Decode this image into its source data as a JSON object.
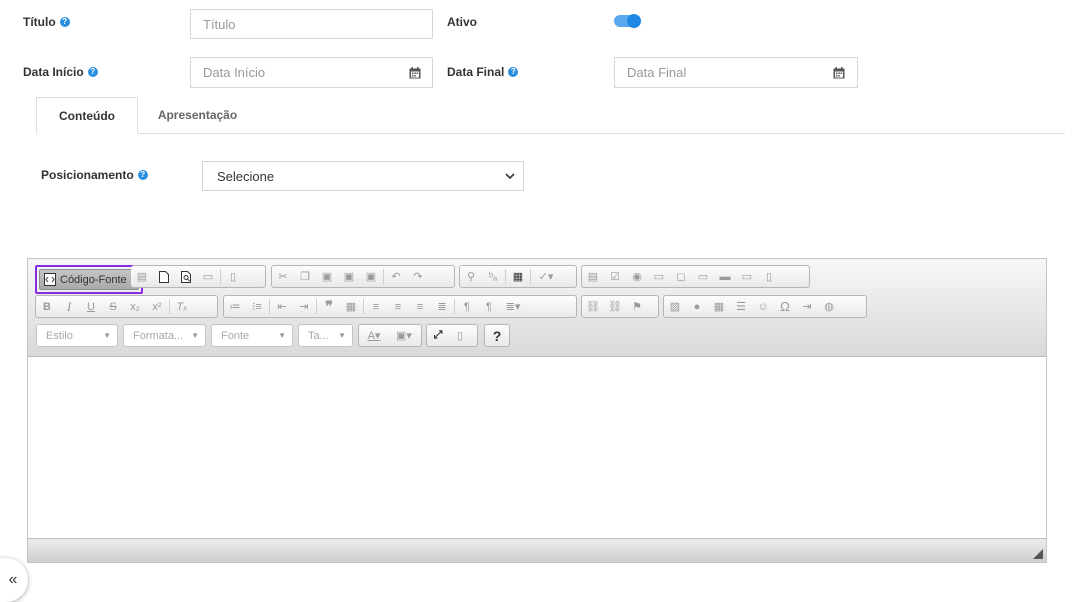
{
  "form": {
    "titulo": {
      "label": "Título",
      "placeholder": "Título"
    },
    "ativo": {
      "label": "Ativo",
      "value": true
    },
    "data_inicio": {
      "label": "Data Início",
      "placeholder": "Data Início"
    },
    "data_final": {
      "label": "Data Final",
      "placeholder": "Data Final"
    },
    "help_glyph": "?"
  },
  "tabs": [
    {
      "label": "Conteúdo",
      "active": true
    },
    {
      "label": "Apresentação",
      "active": false
    }
  ],
  "posicionamento": {
    "label": "Posicionamento",
    "selected": "Selecione"
  },
  "editor": {
    "source_button": "Código-Fonte",
    "combos": {
      "style": "Estilo",
      "format": "Formata...",
      "font": "Fonte",
      "size": "Ta..."
    },
    "help_button": "?"
  },
  "colors": {
    "accent": "#2a8fe0",
    "highlight": "#8a2be2",
    "toggle": "#1e88e5"
  }
}
